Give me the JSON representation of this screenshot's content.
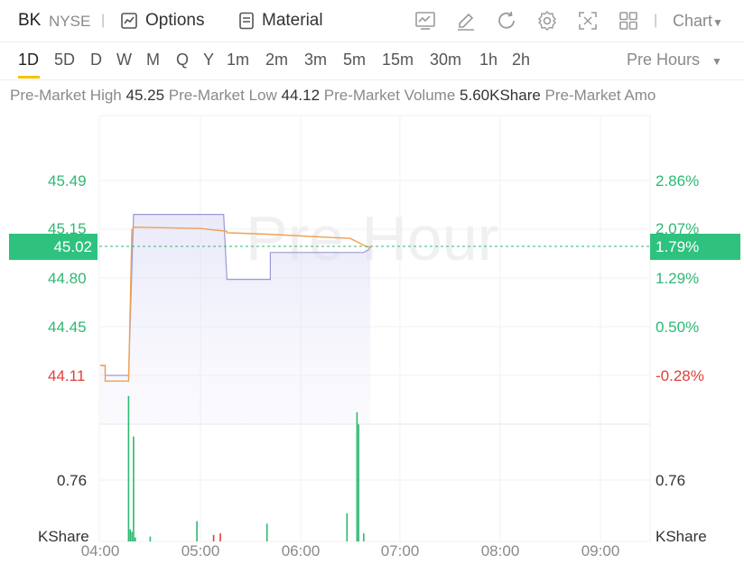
{
  "header": {
    "ticker": "BK",
    "exchange": "NYSE",
    "options_label": "Options",
    "material_label": "Material",
    "chart_selector": "Chart",
    "icons": [
      "chart-icon",
      "draw-icon",
      "refresh-icon",
      "settings-icon",
      "fullscreen-icon",
      "layout-icon"
    ]
  },
  "intervals": {
    "items": [
      "1D",
      "5D",
      "D",
      "W",
      "M",
      "Q",
      "Y",
      "1m",
      "2m",
      "3m",
      "5m",
      "15m",
      "30m",
      "1h",
      "2h"
    ],
    "active": "1D",
    "session_label": "Pre Hours"
  },
  "stats": {
    "high_label": "Pre-Market High",
    "high_value": "45.25",
    "low_label": "Pre-Market Low",
    "low_value": "44.12",
    "volume_label": "Pre-Market Volume",
    "volume_value": "5.60KShare",
    "amount_label": "Pre-Market Amo"
  },
  "chart": {
    "watermark": "Pre Hour",
    "current_price": "45.02",
    "current_pct": "1.79%",
    "colors": {
      "up": "#2eb872",
      "down": "#e0403a",
      "price_line": "#f0a050",
      "avg_line": "#9a9ad6"
    },
    "price_axis": [
      {
        "label": "45.49",
        "value": 45.49,
        "color": "green"
      },
      {
        "label": "45.15",
        "value": 45.15,
        "color": "green"
      },
      {
        "label": "44.80",
        "value": 44.8,
        "color": "green"
      },
      {
        "label": "44.45",
        "value": 44.45,
        "color": "green"
      },
      {
        "label": "44.11",
        "value": 44.11,
        "color": "red"
      }
    ],
    "pct_axis": [
      {
        "label": "2.86%",
        "color": "green"
      },
      {
        "label": "2.07%",
        "color": "green"
      },
      {
        "label": "1.29%",
        "color": "green"
      },
      {
        "label": "0.50%",
        "color": "green"
      },
      {
        "label": "-0.28%",
        "color": "red"
      }
    ],
    "volume_axis": {
      "tick": "0.76",
      "unit": "KShare"
    },
    "time_axis": [
      "04:00",
      "05:00",
      "06:00",
      "07:00",
      "08:00",
      "09:00"
    ]
  },
  "chart_data": {
    "type": "line",
    "x_range": [
      "04:00",
      "09:30"
    ],
    "ylim": [
      43.95,
      45.65
    ],
    "series": [
      {
        "x_minutes": [
          0,
          3,
          3,
          17,
          19,
          20,
          60,
          76,
          76,
          100,
          150,
          160,
          162
        ],
        "values": [
          44.18,
          44.18,
          44.07,
          44.07,
          45.14,
          45.16,
          45.15,
          45.13,
          45.12,
          45.11,
          45.08,
          45.02,
          45.02
        ]
      },
      {
        "x_minutes": [
          0,
          3,
          3,
          17,
          20,
          74,
          76,
          76,
          101,
          102,
          102,
          158,
          161,
          162
        ],
        "values": [
          44.18,
          44.18,
          44.11,
          44.11,
          45.25,
          45.25,
          44.79,
          44.79,
          44.79,
          44.79,
          44.98,
          44.98,
          45.0,
          45.02
        ]
      }
    ],
    "volume": [
      {
        "x_minutes": 17,
        "value": 1.8,
        "dir": "up"
      },
      {
        "x_minutes": 18,
        "value": 0.15,
        "dir": "up"
      },
      {
        "x_minutes": 19,
        "value": 0.12,
        "dir": "up"
      },
      {
        "x_minutes": 20,
        "value": 1.3,
        "dir": "up"
      },
      {
        "x_minutes": 21,
        "value": 0.05,
        "dir": "up"
      },
      {
        "x_minutes": 30,
        "value": 0.06,
        "dir": "up"
      },
      {
        "x_minutes": 58,
        "value": 0.25,
        "dir": "up"
      },
      {
        "x_minutes": 68,
        "value": 0.08,
        "dir": "down"
      },
      {
        "x_minutes": 72,
        "value": 0.1,
        "dir": "down"
      },
      {
        "x_minutes": 100,
        "value": 0.22,
        "dir": "up"
      },
      {
        "x_minutes": 148,
        "value": 0.35,
        "dir": "up"
      },
      {
        "x_minutes": 154,
        "value": 1.6,
        "dir": "up"
      },
      {
        "x_minutes": 155,
        "value": 1.45,
        "dir": "up"
      },
      {
        "x_minutes": 158,
        "value": 0.1,
        "dir": "up"
      }
    ]
  }
}
